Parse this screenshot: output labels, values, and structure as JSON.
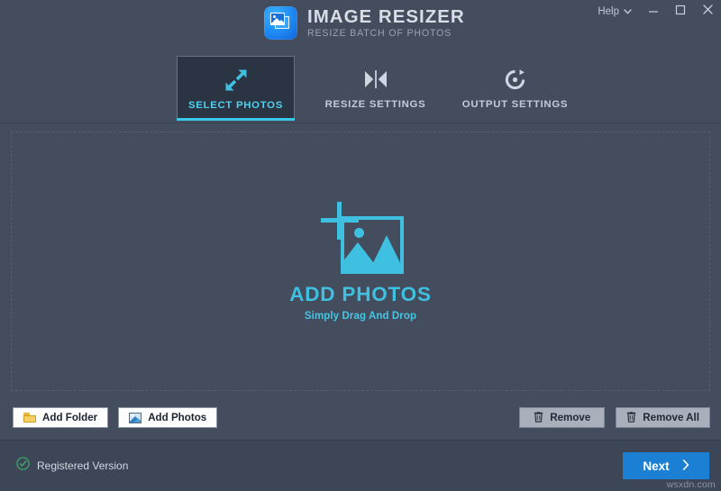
{
  "window": {
    "title": "IMAGE RESIZER",
    "subtitle": "RESIZE BATCH OF PHOTOS",
    "logo_icon": "image-resizer-logo-icon",
    "controls": {
      "help_label": "Help",
      "help_chevron_icon": "chevron-down-icon",
      "minimize_icon": "minimize-icon",
      "maximize_icon": "maximize-icon",
      "close_icon": "close-icon"
    }
  },
  "theme": {
    "window_bg": "#434d5e",
    "footer_bg": "#3d4656",
    "active_tab_bg": "#2b3443",
    "accent_cyan": "#3fc0e0",
    "accent_blue": "#1b7fd4",
    "registered_green": "#3aa968",
    "text_primary": "#d8dde6",
    "text_muted": "#9aa3b2"
  },
  "tabs": [
    {
      "id": "select-photos",
      "label": "SELECT PHOTOS",
      "icon": "resize-diagonal-arrows-icon",
      "active": true
    },
    {
      "id": "resize-settings",
      "label": "RESIZE SETTINGS",
      "icon": "compress-horizontal-icon",
      "active": false
    },
    {
      "id": "output-settings",
      "label": "OUTPUT SETTINGS",
      "icon": "refresh-circle-icon",
      "active": false
    }
  ],
  "dropzone": {
    "icon": "add-photo-frame-icon",
    "title": "ADD PHOTOS",
    "subtitle": "Simply Drag And Drop",
    "border_style": "dashed"
  },
  "actionbar": {
    "left_buttons": [
      {
        "id": "add-folder",
        "label": "Add Folder",
        "icon": "folder-icon"
      },
      {
        "id": "add-photos",
        "label": "Add Photos",
        "icon": "photo-icon"
      }
    ],
    "right_buttons": [
      {
        "id": "remove",
        "label": "Remove",
        "icon": "trash-icon"
      },
      {
        "id": "remove-all",
        "label": "Remove All",
        "icon": "trash-icon"
      }
    ]
  },
  "footer": {
    "registration_icon": "check-circle-icon",
    "registration_label": "Registered Version",
    "next_label": "Next",
    "next_icon": "chevron-right-icon",
    "watermark": "wsxdn.com"
  }
}
